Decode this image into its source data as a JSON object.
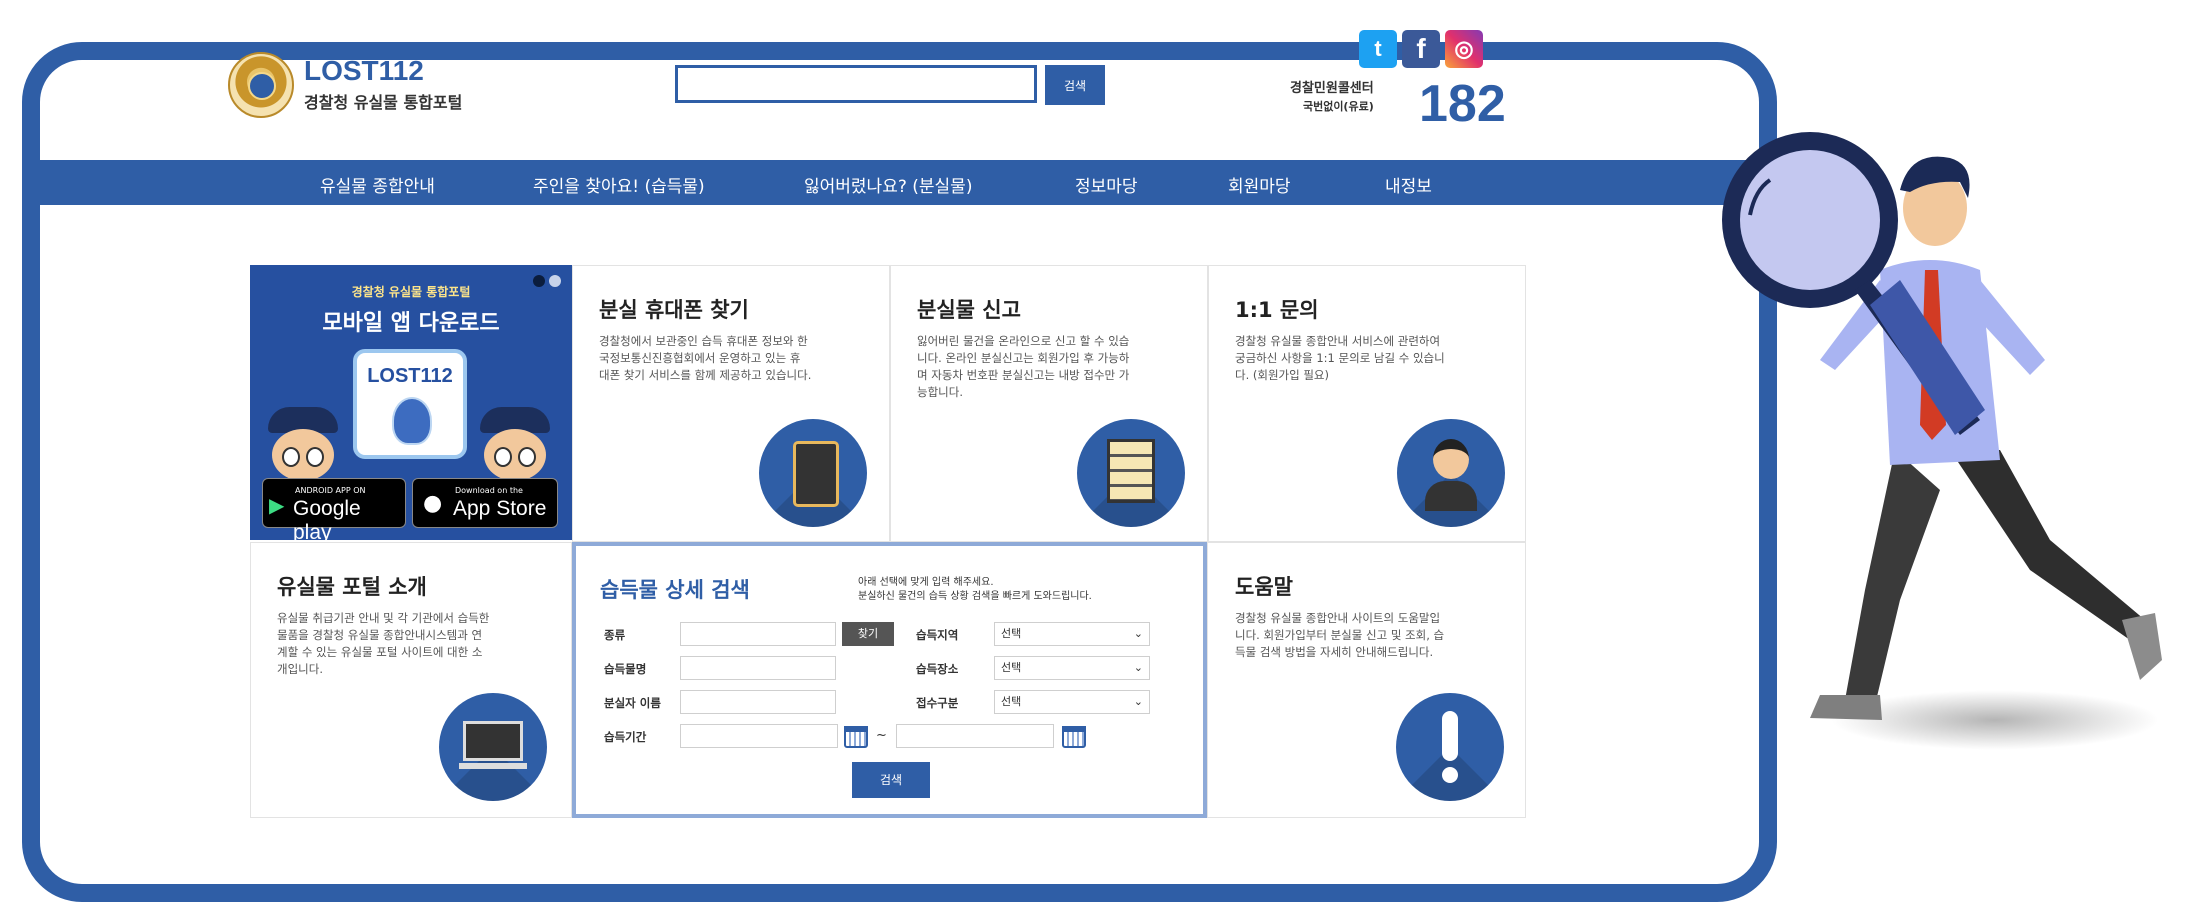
{
  "header": {
    "logo_title": "LOST112",
    "logo_subtitle": "경찰청 유실물 통합포털",
    "search_button": "검색",
    "social": {
      "twitter": "t",
      "facebook": "f",
      "instagram": "◎"
    },
    "callcenter": {
      "label": "경찰민원콜센터",
      "sub": "국번없이(유료)",
      "number": "182"
    }
  },
  "nav": {
    "items": [
      "유실물 종합안내",
      "주인을 찾아요! (습득물)",
      "잃어버렸나요? (분실물)",
      "정보마당",
      "회원마당",
      "내정보"
    ]
  },
  "banner": {
    "top": "경찰청 유실물 통합포털",
    "title": "모바일 앱 다운로드",
    "phone_logo": "LOST112",
    "google_small": "ANDROID APP ON",
    "google_big": "Google play",
    "apple_small": "Download on the",
    "apple_big": "App Store"
  },
  "cards": {
    "phone": {
      "title": "분실 휴대폰 찾기",
      "desc": [
        "경찰청에서 보관중인 습득 휴대폰 정보와 한",
        "국정보통신진흥협회에서 운영하고 있는 휴",
        "대폰 찾기 서비스를 함께 제공하고 있습니다."
      ]
    },
    "report": {
      "title": "분실물 신고",
      "desc": [
        "잃어버린 물건을 온라인으로 신고 할 수 있습",
        "니다. 온라인 분실신고는 회원가입 후 가능하",
        "며 자동차 번호판 분실신고는 내방 접수만 가",
        "능합니다."
      ]
    },
    "inquiry": {
      "title": "1:1 문의",
      "desc": [
        "경찰청 유실물 종합안내 서비스에 관련하여",
        "궁금하신 사항을 1:1 문의로 남길 수 있습니",
        "다. (회원가입 필요)"
      ]
    },
    "intro": {
      "title": "유실물 포털 소개",
      "desc": [
        "유실물 취급기관 안내 및 각 기관에서 습득한",
        "물품을 경찰청 유실물 종합안내시스템과 연",
        "계할 수 있는 유실물 포털 사이트에 대한 소",
        "개입니다."
      ]
    },
    "help": {
      "title": "도움말",
      "desc": [
        "경찰청 유실물 종합안내 사이트의 도움말입",
        "니다. 회원가입부터 분실물 신고 및 조회, 습",
        "득물 검색 방법을 자세히 안내해드립니다."
      ]
    }
  },
  "detail_search": {
    "title": "습득물 상세 검색",
    "note": [
      "아래 선택에 맞게 입력 해주세요.",
      "분실하신 물건의 습득 상황 검색을 빠르게 도와드립니다."
    ],
    "labels": {
      "type": "종류",
      "item_name": "습득물명",
      "owner_name": "분실자 이름",
      "period": "습득기간",
      "region": "습득지역",
      "place": "습득장소",
      "category": "접수구분"
    },
    "find_button": "찾기",
    "select_default": "선택",
    "tilde": "~",
    "search_button": "검색"
  }
}
